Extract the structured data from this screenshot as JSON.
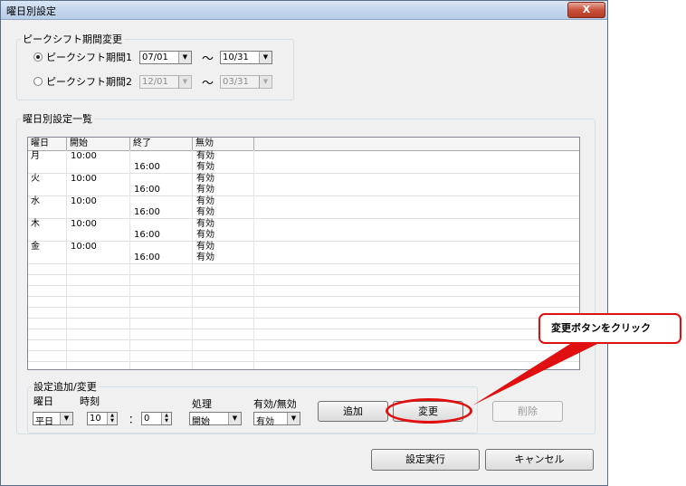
{
  "window": {
    "title": "曜日別設定",
    "close_label": "X"
  },
  "peak_group": {
    "legend": "ピークシフト期間変更",
    "period1": {
      "label": "ピークシフト期間1",
      "from": "07/01",
      "to": "10/31",
      "selected": true
    },
    "period2": {
      "label": "ピークシフト期間2",
      "from": "12/01",
      "to": "03/31",
      "selected": false
    },
    "tilde": "〜"
  },
  "list_group": {
    "legend": "曜日別設定一覧",
    "columns": [
      "曜日",
      "開始",
      "終了",
      "無効"
    ],
    "rows": [
      {
        "day": "月",
        "start": "10:00",
        "end": "",
        "flag": "有効"
      },
      {
        "day": "",
        "start": "",
        "end": "16:00",
        "flag": "有効"
      },
      {
        "day": "火",
        "start": "10:00",
        "end": "",
        "flag": "有効"
      },
      {
        "day": "",
        "start": "",
        "end": "16:00",
        "flag": "有効"
      },
      {
        "day": "水",
        "start": "10:00",
        "end": "",
        "flag": "有効"
      },
      {
        "day": "",
        "start": "",
        "end": "16:00",
        "flag": "有効"
      },
      {
        "day": "木",
        "start": "10:00",
        "end": "",
        "flag": "有効"
      },
      {
        "day": "",
        "start": "",
        "end": "16:00",
        "flag": "有効"
      },
      {
        "day": "金",
        "start": "10:00",
        "end": "",
        "flag": "有効"
      },
      {
        "day": "",
        "start": "",
        "end": "16:00",
        "flag": "有効"
      }
    ]
  },
  "edit_group": {
    "legend": "設定追加/変更",
    "day_label": "曜日",
    "day_value": "平日",
    "time_label": "時刻",
    "hour_value": "10",
    "colon": "：",
    "minute_value": "0",
    "action_label": "処理",
    "action_value": "開始",
    "valid_label": "有効/無効",
    "valid_value": "有効",
    "add_label": "追加",
    "change_label": "変更",
    "delete_label": "削除"
  },
  "footer": {
    "execute_label": "設定実行",
    "cancel_label": "キャンセル"
  },
  "annotation": {
    "callout_text": "変更ボタンをクリック",
    "color": "#e01010"
  }
}
